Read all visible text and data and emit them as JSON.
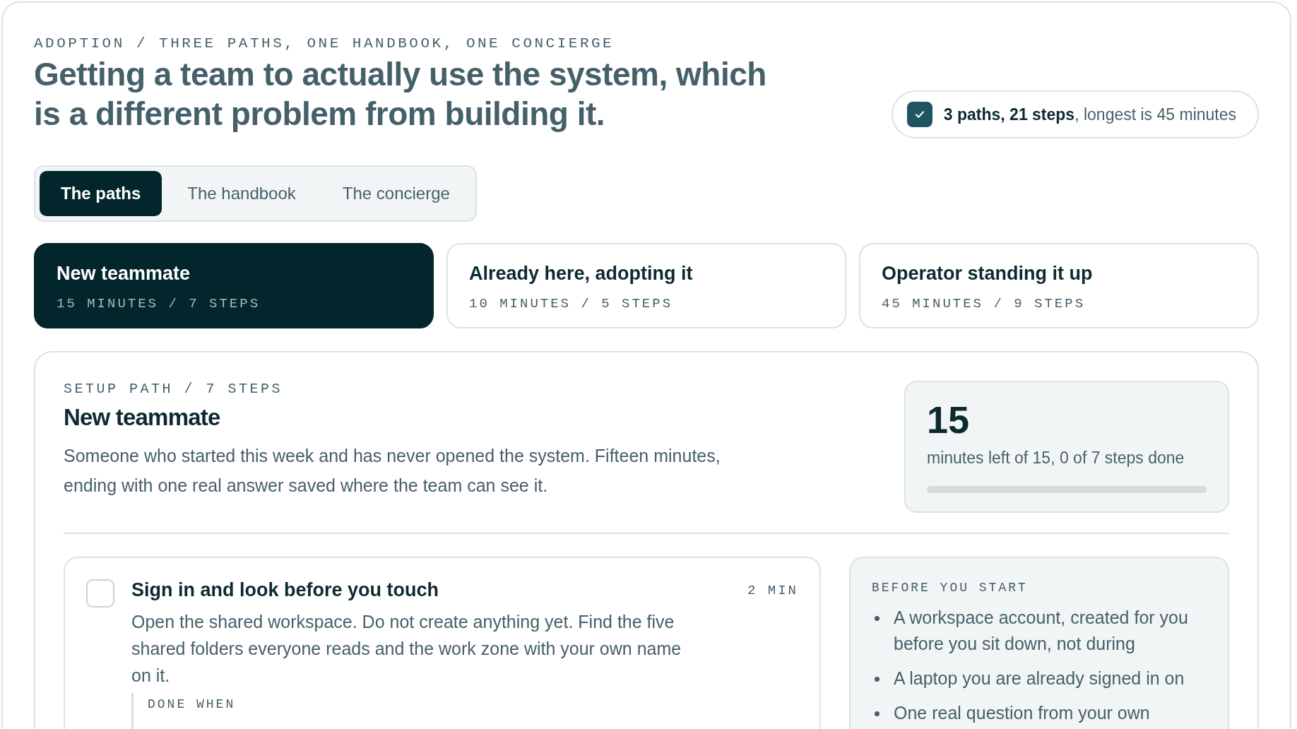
{
  "eyebrow": "ADOPTION / THREE PATHS, ONE HANDBOOK, ONE CONCIERGE",
  "title": "Getting a team to actually use the system, which is a different problem from building it.",
  "summary": {
    "checked": true,
    "text": "**3 paths, 21 steps**, longest is 45 minutes"
  },
  "tabs": [
    {
      "label": "The paths",
      "selected": true
    },
    {
      "label": "The handbook",
      "selected": false
    },
    {
      "label": "The concierge",
      "selected": false
    }
  ],
  "paths": [
    {
      "name": "New teammate",
      "meta": "15 MINUTES / 7 STEPS",
      "selected": true
    },
    {
      "name": "Already here, adopting it",
      "meta": "10 MINUTES / 5 STEPS",
      "selected": false
    },
    {
      "name": "Operator standing it up",
      "meta": "45 MINUTES / 9 STEPS",
      "selected": false
    }
  ],
  "detail": {
    "eyebrow": "SETUP PATH / 7 STEPS",
    "title": "New teammate",
    "description": "Someone who started this week and has never opened the system. Fifteen minutes, ending with one real answer saved where the team can see it.",
    "stat": {
      "value": "15",
      "caption": "minutes left of 15, 0 of 7 steps done",
      "level": 0
    },
    "steps": [
      {
        "title": "Sign in and look before you touch",
        "duration": "2 MIN",
        "checked": false,
        "body": "Open the shared workspace. Do not create anything yet. Find the five shared folders everyone reads and the work zone with your own name on it.",
        "done_label": "DONE WHEN"
      }
    ],
    "before": {
      "heading": "BEFORE YOU START",
      "items": [
        "A workspace account, created for you before you sit down, not during",
        "A laptop you are already signed in on",
        "One real question from your own"
      ]
    }
  }
}
